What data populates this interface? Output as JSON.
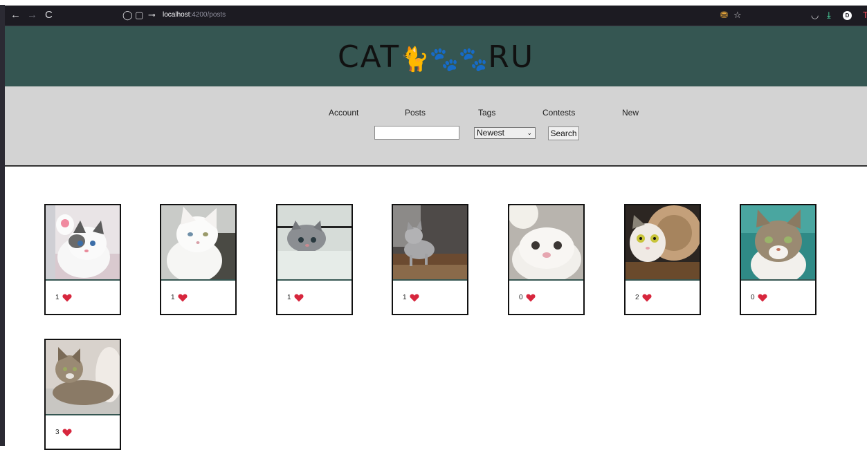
{
  "browser": {
    "url_host": "localhost",
    "url_path": ":4200/posts",
    "profile_initial": "D"
  },
  "site": {
    "logo_text_left": "CAT",
    "logo_paws": "🐈🐾🐾",
    "logo_text_right": "RU"
  },
  "nav": {
    "items": [
      "Account",
      "Posts",
      "Tags",
      "Contests",
      "New"
    ]
  },
  "search": {
    "value": "",
    "sort_selected": "Newest",
    "button_label": "Search"
  },
  "posts": [
    {
      "likes": "1"
    },
    {
      "likes": "1"
    },
    {
      "likes": "1"
    },
    {
      "likes": "1"
    },
    {
      "likes": "0"
    },
    {
      "likes": "2"
    },
    {
      "likes": "0"
    },
    {
      "likes": "3"
    }
  ],
  "colors": {
    "header_bg": "#355652",
    "nav_bg": "#d3d3d3",
    "heart": "#d7263d"
  }
}
